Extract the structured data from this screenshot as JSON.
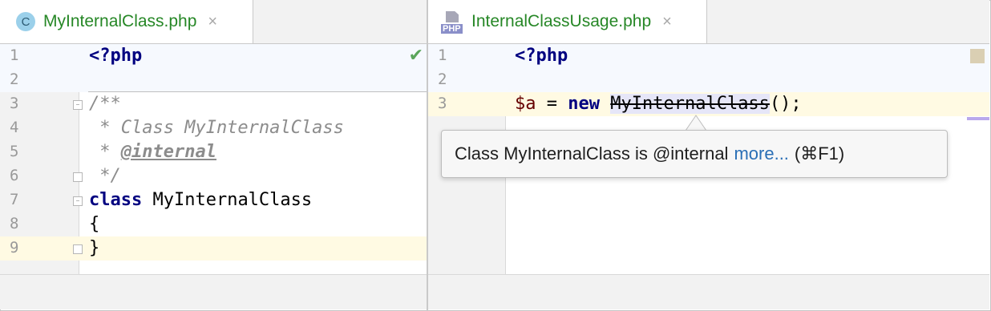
{
  "left_editor": {
    "tab": {
      "label": "MyInternalClass.php",
      "icon_letter": "C",
      "close": "×"
    },
    "lines": [
      {
        "num": "1"
      },
      {
        "num": "2"
      },
      {
        "num": "3"
      },
      {
        "num": "4"
      },
      {
        "num": "5"
      },
      {
        "num": "6"
      },
      {
        "num": "7"
      },
      {
        "num": "8"
      },
      {
        "num": "9"
      }
    ],
    "code": {
      "l1": "<?php",
      "l3": "/**",
      "l4": " * Class MyInternalClass",
      "l5_prefix": " * ",
      "l5_tag": "@internal",
      "l6": " */",
      "l7_kw": "class",
      "l7_name": " MyInternalClass",
      "l8": "{",
      "l9": "}"
    },
    "status_icon": "checkmark-icon",
    "status_glyph": "✔"
  },
  "right_editor": {
    "tab": {
      "label": "InternalClassUsage.php",
      "icon_label": "PHP",
      "close": "×"
    },
    "lines": [
      {
        "num": "1"
      },
      {
        "num": "2"
      },
      {
        "num": "3"
      }
    ],
    "code": {
      "l1": "<?php",
      "l3_var": "$a",
      "l3_eq": " = ",
      "l3_kw": "new",
      "l3_space": " ",
      "l3_class": "MyInternalClass",
      "l3_tail": "();"
    }
  },
  "tooltip": {
    "message": "Class MyInternalClass is @internal",
    "link": "more...",
    "shortcut": "(⌘F1)"
  },
  "colors": {
    "tab_text": "#268726",
    "keyword": "#000080",
    "link": "#2a6fb6",
    "current_line": "#fffae3"
  }
}
